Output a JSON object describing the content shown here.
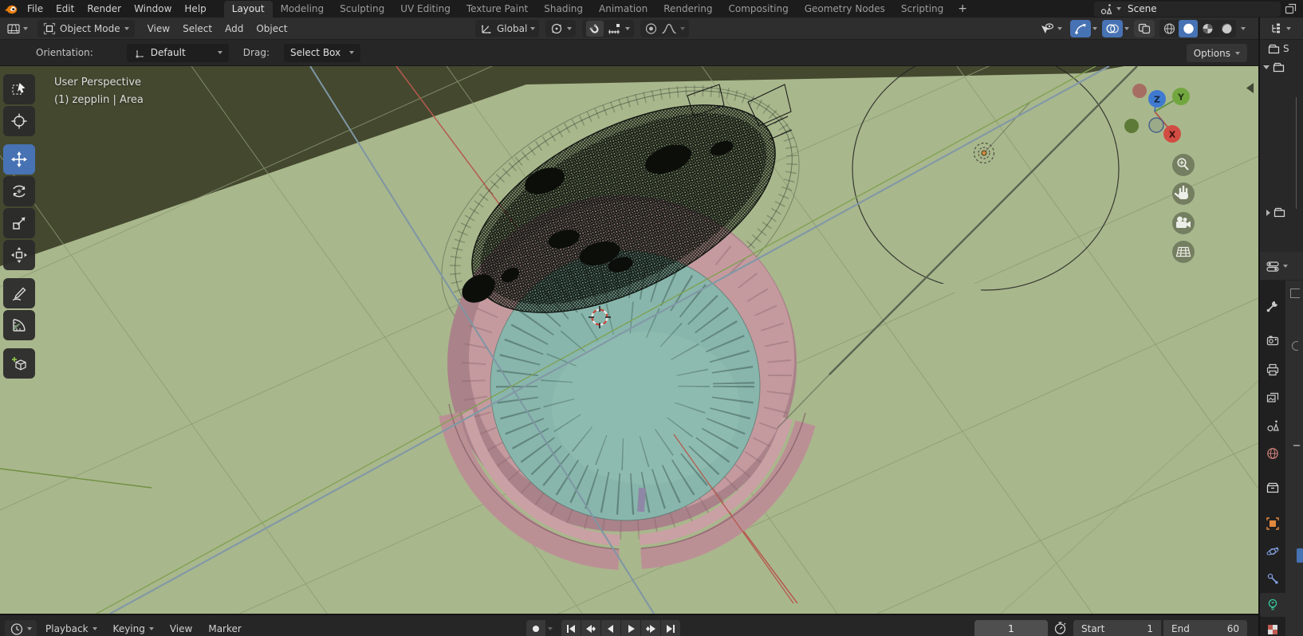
{
  "topbar": {
    "menus": [
      "File",
      "Edit",
      "Render",
      "Window",
      "Help"
    ],
    "workspaces": [
      "Layout",
      "Modeling",
      "Sculpting",
      "UV Editing",
      "Texture Paint",
      "Shading",
      "Animation",
      "Rendering",
      "Compositing",
      "Geometry Nodes",
      "Scripting"
    ],
    "active_workspace": "Layout",
    "add_workspace_label": "+",
    "scene_name": "Scene"
  },
  "viewport_header": {
    "mode": "Object Mode",
    "menus": [
      "View",
      "Select",
      "Add",
      "Object"
    ],
    "transform_orientation": "Global"
  },
  "tool_settings": {
    "orientation_label": "Orientation:",
    "orientation_value": "Default",
    "drag_label": "Drag:",
    "drag_value": "Select Box",
    "options_label": "Options"
  },
  "viewport": {
    "overlay_line1": "User Perspective",
    "overlay_line2": "(1) zepplin | Area",
    "gizmo_labels": {
      "x": "X",
      "y": "Y",
      "z": "Z"
    },
    "view_controls": [
      "zoom",
      "pan",
      "camera-view",
      "toggle-orthographic"
    ]
  },
  "toolbar": {
    "tools": [
      "select-box",
      "cursor",
      "move",
      "rotate",
      "scale",
      "transform",
      "annotate",
      "measure",
      "add-cube"
    ],
    "active_tool": "move"
  },
  "outliner": {
    "visible_row_label": "S"
  },
  "properties": {
    "tabs": [
      "tool",
      "render",
      "output",
      "view-layer",
      "scene",
      "world",
      "collection",
      "object",
      "physics",
      "constraints",
      "object-data",
      "texture"
    ],
    "active_tab": "object-data"
  },
  "timeline": {
    "playback_label": "Playback",
    "keying_label": "Keying",
    "view_label": "View",
    "marker_label": "Marker",
    "current_frame": "1",
    "start_label": "Start",
    "start_value": "1",
    "end_label": "End",
    "end_value": "60"
  },
  "colors": {
    "accent_blue": "#4772b3",
    "viewport_green": "#a9b78c",
    "backdrop_olive": "#44482f",
    "dome_teal": "#88b6ac",
    "bowl_pink": "#c49a9e",
    "object_orange": "#e0883d",
    "active_data_green": "#35cb9e"
  }
}
